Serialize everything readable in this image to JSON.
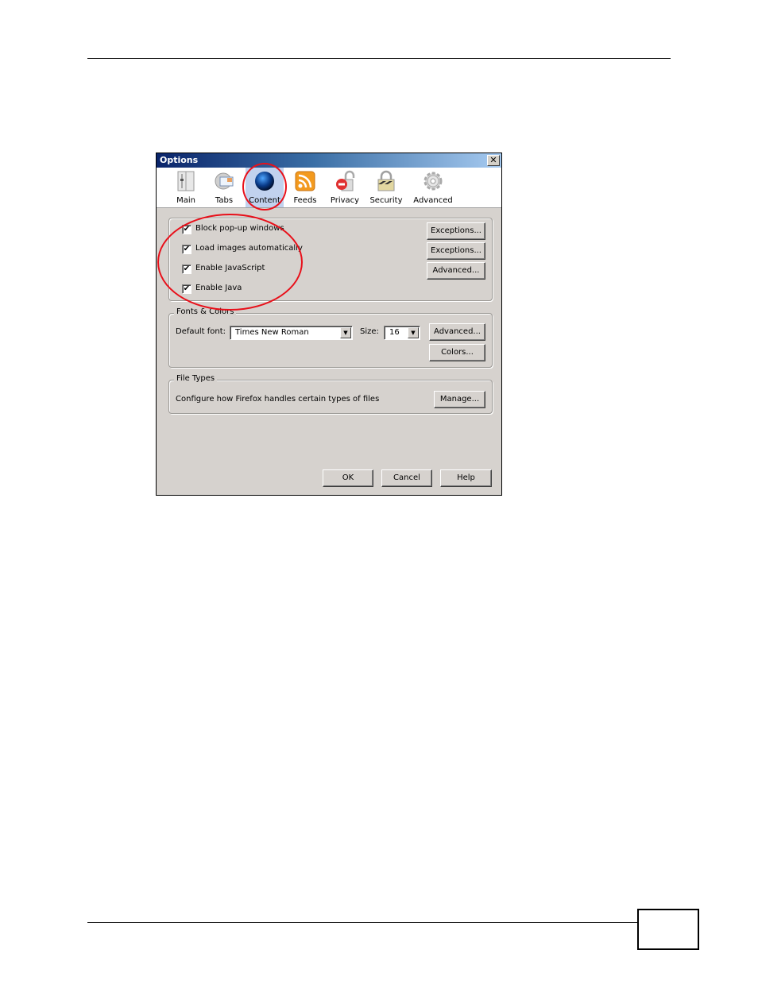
{
  "dialog": {
    "title": "Options",
    "close_label": "✕",
    "panes": [
      {
        "label": "Main",
        "icon": "main-pane-icon",
        "selected": false
      },
      {
        "label": "Tabs",
        "icon": "tabs-pane-icon",
        "selected": false
      },
      {
        "label": "Content",
        "icon": "content-globe-icon",
        "selected": true
      },
      {
        "label": "Feeds",
        "icon": "rss-feed-icon",
        "selected": false
      },
      {
        "label": "Privacy",
        "icon": "privacy-lock-icon",
        "selected": false
      },
      {
        "label": "Security",
        "icon": "security-padlock-icon",
        "selected": false
      },
      {
        "label": "Advanced",
        "icon": "advanced-gear-icon",
        "selected": false
      }
    ],
    "content_group": {
      "checkboxes": [
        {
          "label": "Block pop-up windows",
          "checked": true,
          "button": "Exceptions..."
        },
        {
          "label": "Load images automatically",
          "checked": true,
          "button": "Exceptions..."
        },
        {
          "label": "Enable JavaScript",
          "checked": true,
          "button": "Advanced..."
        },
        {
          "label": "Enable Java",
          "checked": true
        }
      ],
      "check_mark": "✔"
    },
    "fonts_colors": {
      "legend": "Fonts & Colors",
      "default_font_label": "Default font:",
      "default_font_value": "Times New Roman",
      "size_label": "Size:",
      "size_value": "16",
      "advanced_button": "Advanced...",
      "colors_button": "Colors...",
      "dropdown_arrow": "▼"
    },
    "file_types": {
      "legend": "File Types",
      "description": "Configure how Firefox handles certain types of files",
      "manage_button": "Manage..."
    },
    "footer": {
      "ok": "OK",
      "cancel": "Cancel",
      "help": "Help"
    }
  },
  "annotation_color": "#e8101a"
}
